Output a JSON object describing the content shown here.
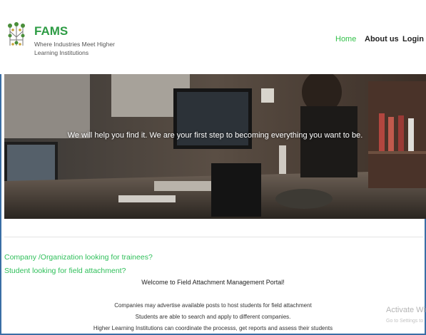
{
  "brand": {
    "name": "FAMS",
    "tagline": "Where Industries Meet Higher Learning Institutions"
  },
  "nav": {
    "items": [
      {
        "label": "Home"
      },
      {
        "label": "About us"
      },
      {
        "label": "Login"
      }
    ],
    "active_color": "#33c14a"
  },
  "hero": {
    "message": "We will help you find it. We are your first step to becoming everything you want to be."
  },
  "content": {
    "question_company": "Company /Organization looking for trainees?",
    "question_student": "Student looking for field attachment?",
    "welcome": "Welcome to Field Attachment Management Portal!",
    "info": [
      "Companies may advertise available posts to host students for field attachment",
      "Students are able to search and apply to different companies.",
      "Higher Learning Institutions can coordinate the processs, get reports and assess their students"
    ],
    "accent_color": "#2fbf5a"
  },
  "watermark": {
    "title": "Activate Win",
    "subtitle": "Go to Settings to"
  }
}
